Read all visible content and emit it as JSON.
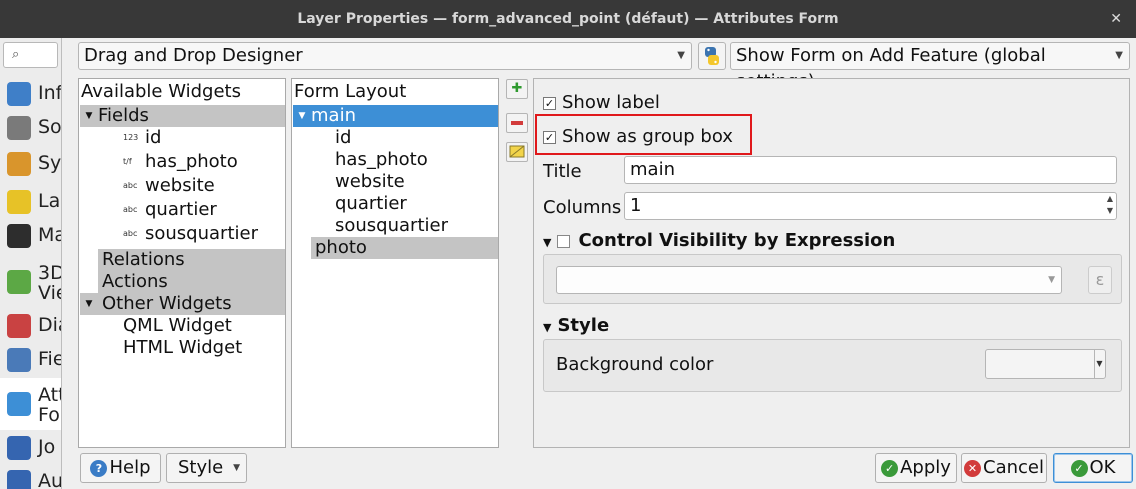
{
  "window": {
    "title": "Layer Properties — form_advanced_point (défaut) — Attributes Form",
    "close_glyph": "✕"
  },
  "sidebar": {
    "search_glyph": "⌕",
    "items": [
      {
        "label": "Inf",
        "icon": "information-icon",
        "color": "#3f7fc8"
      },
      {
        "label": "So",
        "icon": "source-icon",
        "color": "#7a7a7a"
      },
      {
        "label": "Sy",
        "icon": "symbology-icon",
        "color": "#d9952c"
      },
      {
        "label": "La",
        "icon": "labels-icon",
        "color": "#e7c227"
      },
      {
        "label": "Ma",
        "icon": "masks-icon",
        "color": "#2d2d2d"
      },
      {
        "label": "3D\nVie",
        "icon": "3d-view-icon",
        "color": "#5ca845"
      },
      {
        "label": "Dia",
        "icon": "diagrams-icon",
        "color": "#c94242"
      },
      {
        "label": "Fie",
        "icon": "fields-icon",
        "color": "#4a7ab8"
      },
      {
        "label": "Att\nFo",
        "icon": "attributes-form-icon",
        "color": "#3d8fd6"
      },
      {
        "label": "Jo",
        "icon": "joins-icon",
        "color": "#3565b0"
      },
      {
        "label": "Au",
        "icon": "auxiliary-storage-icon",
        "color": "#3565b0"
      }
    ]
  },
  "toolbar": {
    "designer_combo": "Drag and Drop Designer",
    "form_suppress_combo": "Show Form on Add Feature (global settings)"
  },
  "available_widgets": {
    "header": "Available Widgets",
    "fields_label": "Fields",
    "fields": [
      {
        "tag": "123",
        "name": "id"
      },
      {
        "tag": "t/f",
        "name": "has_photo"
      },
      {
        "tag": "abc",
        "name": "website"
      },
      {
        "tag": "abc",
        "name": "quartier"
      },
      {
        "tag": "abc",
        "name": "sousquartier"
      }
    ],
    "relations_label": "Relations",
    "actions_label": "Actions",
    "other_widgets_label": "Other Widgets",
    "other_widgets": [
      "QML Widget",
      "HTML Widget"
    ]
  },
  "form_layout": {
    "header": "Form Layout",
    "main_label": "main",
    "main_children": [
      "id",
      "has_photo",
      "website",
      "quartier",
      "sousquartier"
    ],
    "photo_label": "photo"
  },
  "properties": {
    "show_label": "Show label",
    "show_as_group_box": "Show as group box",
    "title_label": "Title",
    "title_value": "main",
    "columns_label": "Columns",
    "columns_value": "1",
    "control_visibility": "Control Visibility by Expression",
    "style_section": "Style",
    "background_color_label": "Background color",
    "epsilon_glyph": "ε"
  },
  "footer": {
    "help": "Help",
    "style": "Style",
    "apply": "Apply",
    "cancel": "Cancel",
    "ok": "OK"
  }
}
